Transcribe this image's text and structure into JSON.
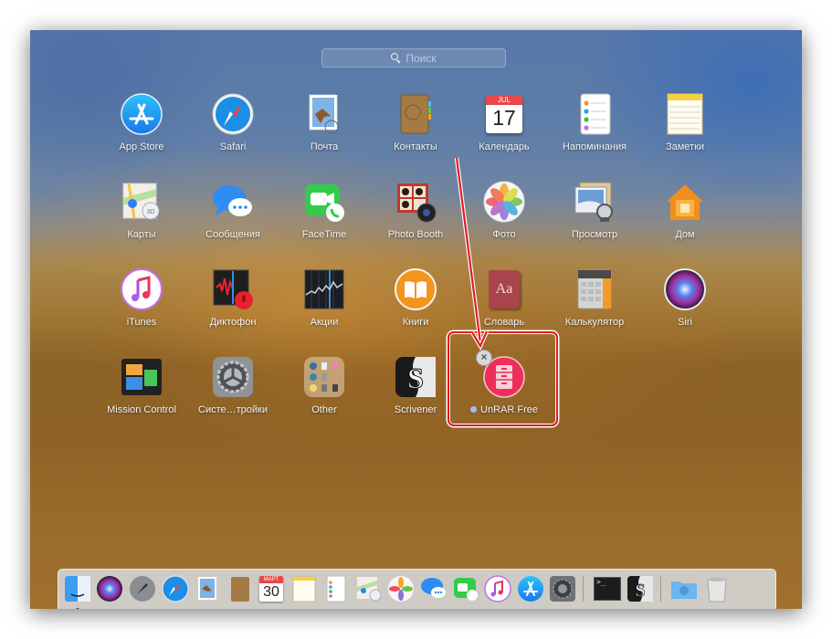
{
  "search": {
    "placeholder": "Поиск"
  },
  "apps": [
    {
      "label": "App Store"
    },
    {
      "label": "Safari"
    },
    {
      "label": "Почта"
    },
    {
      "label": "Контакты"
    },
    {
      "label": "Календарь",
      "month": "JUL",
      "day": "17"
    },
    {
      "label": "Напоминания"
    },
    {
      "label": "Заметки"
    },
    {
      "label": "Карты"
    },
    {
      "label": "Сообщения"
    },
    {
      "label": "FaceTime"
    },
    {
      "label": "Photo Booth"
    },
    {
      "label": "Фото"
    },
    {
      "label": "Просмотр"
    },
    {
      "label": "Дом"
    },
    {
      "label": "iTunes"
    },
    {
      "label": "Диктофон"
    },
    {
      "label": "Акции"
    },
    {
      "label": "Книги"
    },
    {
      "label": "Словарь",
      "glyph": "Aa"
    },
    {
      "label": "Калькулятор"
    },
    {
      "label": "Siri"
    },
    {
      "label": "Mission Control"
    },
    {
      "label": "Систе…тройки"
    },
    {
      "label": "Other"
    },
    {
      "label": "Scrivener"
    },
    {
      "label": "UnRAR Free",
      "is_new": true,
      "deletable": true
    }
  ],
  "delete_badge": "×",
  "dock": {
    "calendar_month": "МАРТ",
    "calendar_day": "30",
    "items": [
      "Finder",
      "Siri",
      "Launchpad",
      "Safari",
      "Почта",
      "Контакты",
      "Календарь",
      "Заметки",
      "Напоминания",
      "Карты",
      "Фото",
      "Сообщения",
      "FaceTime",
      "iTunes",
      "App Store",
      "Системные настройки",
      "Терминал",
      "Scrivener",
      "Загрузки",
      "Корзина"
    ],
    "terminal_prompt": ">_"
  },
  "colors": {
    "highlight": "#e21b23",
    "new_dot": "#9fc0f0"
  }
}
